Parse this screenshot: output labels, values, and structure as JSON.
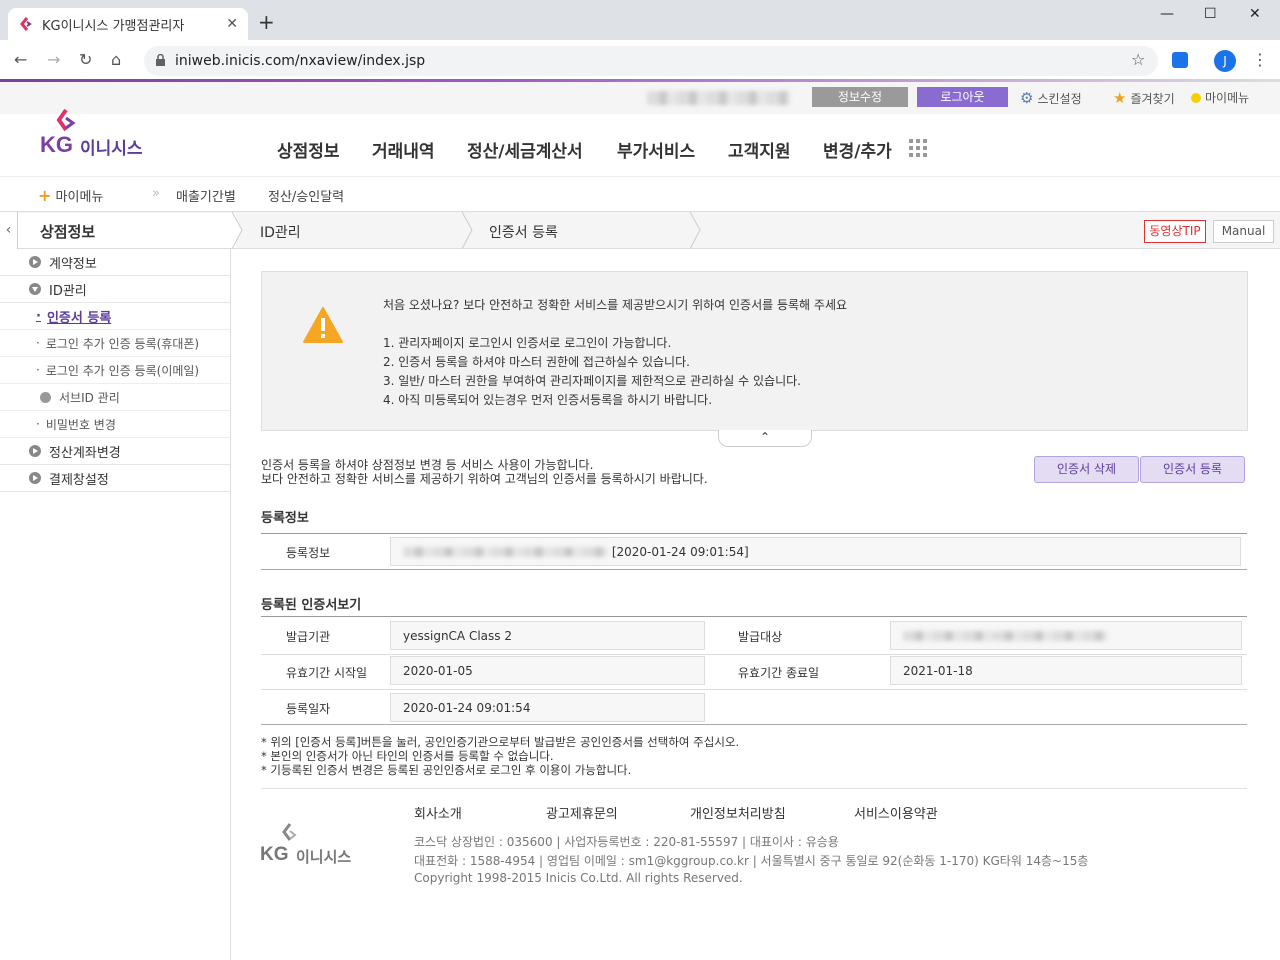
{
  "browser": {
    "tab_title": "KG이니시스 가맹점관리자",
    "close": "✕",
    "new_tab": "+",
    "url": "iniweb.inicis.com/nxaview/index.jsp",
    "profile_initial": "J"
  },
  "top_bar": {
    "info_edit": "정보수정",
    "logout": "로그아웃",
    "skin": "스킨설정",
    "favorites": "즐겨찾기",
    "my_menu": "마이메뉴"
  },
  "logo": {
    "kg": "KG",
    "name": "이니시스"
  },
  "gnb": [
    "상점정보",
    "거래내역",
    "정산/세금계산서",
    "부가서비스",
    "고객지원",
    "변경/추가"
  ],
  "subnav": {
    "my_menu": "마이메뉴",
    "item1": "매출기간별",
    "item2": "정산/승인달력"
  },
  "breadcrumb": {
    "level1": "상점정보",
    "level2": "ID관리",
    "level3": "인증서 등록",
    "tip": "동영상TIP",
    "manual": "Manual"
  },
  "sidebar": {
    "items": [
      {
        "label": "계약정보"
      },
      {
        "label": "ID관리"
      },
      {
        "label": "인증서 등록"
      },
      {
        "label": "로그인 추가 인증 등록(휴대폰)"
      },
      {
        "label": "로그인 추가 인증 등록(이메일)"
      },
      {
        "label": "서브ID 관리"
      },
      {
        "label": "비밀번호 변경"
      },
      {
        "label": "정산계좌변경"
      },
      {
        "label": "결제창설정"
      }
    ]
  },
  "notice": {
    "title": "처음 오셨나요? 보다 안전하고 정확한 서비스를 제공받으시기 위하여 인증서를 등록해 주세요",
    "lines": [
      "1. 관리자페이지 로그인시 인증서로 로그인이 가능합니다.",
      "2. 인증서 등록을 하셔야 마스터 권한에 접근하실수 있습니다.",
      "3. 일반/ 마스터 권한을 부여하여 관리자페이지를 제한적으로 관리하실 수 있습니다.",
      "4. 아직 미등록되어 있는경우 먼저 인증서등록을 하시기 바랍니다."
    ],
    "collapse": "⌃"
  },
  "desc": {
    "line1": "인증서 등록을 하셔야 상점정보 변경 등 서비스 사용이 가능합니다.",
    "line2": "보다 안전하고 정확한 서비스를 제공하기 위하여 고객님의 인증서를 등록하시기 바랍니다."
  },
  "buttons": {
    "delete": "인증서 삭제",
    "register": "인증서 등록"
  },
  "reg_info": {
    "section": "등록정보",
    "label": "등록정보",
    "value_suffix": "[2020-01-24 09:01:54]"
  },
  "cert": {
    "section": "등록된 인증서보기",
    "issuer_label": "발급기관",
    "issuer": "yessignCA Class 2",
    "subject_label": "발급대상",
    "start_label": "유효기간 시작일",
    "start": "2020-01-05",
    "end_label": "유효기간 종료일",
    "end": "2021-01-18",
    "reg_date_label": "등록일자",
    "reg_date": "2020-01-24 09:01:54"
  },
  "footnotes": [
    "* 위의 [인증서 등록]버튼을 눌러, 공인인증기관으로부터 발급받은 공인인증서를 선택하여 주십시오.",
    "* 본인의 인증서가 아닌 타인의 인증서를 등록할 수 없습니다.",
    "* 기등록된 인증서 변경은 등록된 공인인증서로 로그인 후 이용이 가능합니다."
  ],
  "footer": {
    "links": [
      "회사소개",
      "광고제휴문의",
      "개인정보처리방침",
      "서비스이용약관"
    ],
    "info1": "코스닥 상장법인 : 035600  |  사업자등록번호 : 220-81-55597  |  대표이사 : 유승용",
    "info2": "대표전화 : 1588-4954  |  영업팀 이메일 : sm1@kggroup.co.kr  |  서울특별시 중구 통일로 92(순화동 1-170) KG타워 14층~15층",
    "copyright": "Copyright 1998-2015 Inicis Co.Ltd. All rights Reserved."
  },
  "colors": {
    "brand_purple": "#5b3ca0",
    "logout_bg": "#8a6cd1",
    "tip_red": "#e03030",
    "warning": "#f5a623"
  }
}
